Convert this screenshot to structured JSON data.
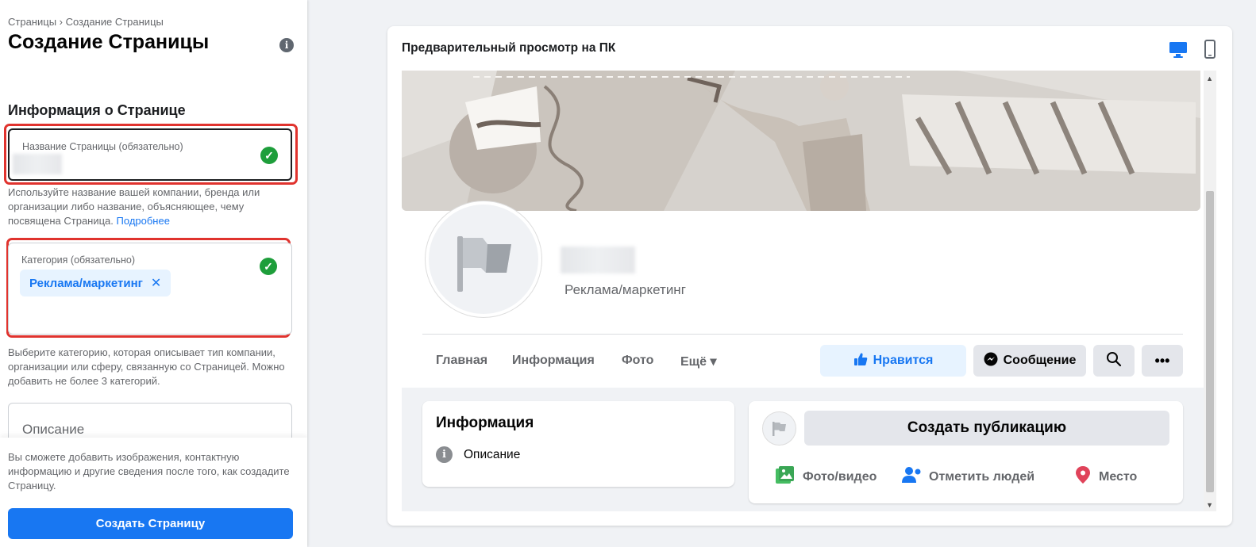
{
  "sidebar": {
    "breadcrumb": "Страницы › Создание Страницы",
    "title": "Создание Страницы",
    "section_title": "Информация о Странице",
    "name_field": {
      "label": "Название Страницы (обязательно)",
      "value": ""
    },
    "name_help": "Используйте название вашей компании, бренда или организации либо название, объясняющее, чему посвящена Страница.",
    "name_help_link": "Подробнее",
    "category_field": {
      "label": "Категория (обязательно)",
      "chip": "Реклама/маркетинг"
    },
    "category_help": "Выберите категорию, которая описывает тип компании, организации или сферу, связанную со Страницей. Можно добавить не более 3 категорий.",
    "description_field": {
      "label": "Описание"
    },
    "bottom_help": "Вы сможете добавить изображения, контактную информацию и другие сведения после того, как создадите Страницу.",
    "create_button": "Создать Страницу"
  },
  "preview": {
    "title": "Предварительный просмотр на ПК",
    "page": {
      "category": "Реклама/маркетинг",
      "tabs": [
        "Главная",
        "Информация",
        "Фото",
        "Ещё ▾"
      ],
      "like_button": "Нравится",
      "message_button": "Сообщение",
      "info_card": {
        "title": "Информация",
        "row": "Описание"
      },
      "post_card": {
        "create_post": "Создать публикацию",
        "actions": [
          "Фото/видео",
          "Отметить людей",
          "Место"
        ]
      }
    }
  },
  "colors": {
    "accent": "#1877f2",
    "highlight": "#e0332e",
    "success": "#1e9e3b"
  }
}
